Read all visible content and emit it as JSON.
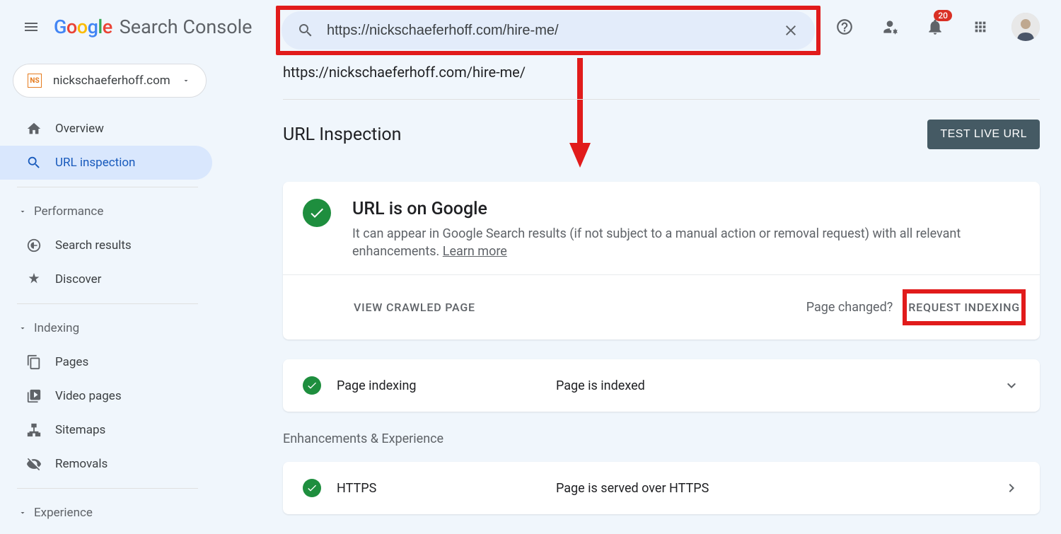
{
  "header": {
    "product_name": "Search Console",
    "search_value": "https://nickschaeferhoff.com/hire-me/",
    "notification_count": "20"
  },
  "sidebar": {
    "property": "nickschaeferhoff.com",
    "favicon_label": "NS",
    "items": {
      "overview": "Overview",
      "url_inspection": "URL inspection"
    },
    "sections": {
      "performance": {
        "title": "Performance",
        "items": {
          "search_results": "Search results",
          "discover": "Discover"
        }
      },
      "indexing": {
        "title": "Indexing",
        "items": {
          "pages": "Pages",
          "video_pages": "Video pages",
          "sitemaps": "Sitemaps",
          "removals": "Removals"
        }
      },
      "experience": {
        "title": "Experience"
      }
    }
  },
  "main": {
    "inspected_url": "https://nickschaeferhoff.com/hire-me/",
    "page_title": "URL Inspection",
    "test_live_btn": "TEST LIVE URL",
    "status": {
      "title": "URL is on Google",
      "desc": "It can appear in Google Search results (if not subject to a manual action or removal request) with all relevant enhancements. ",
      "learn_more": "Learn more"
    },
    "view_crawled": "VIEW CRAWLED PAGE",
    "page_changed": "Page changed?",
    "request_indexing": "REQUEST INDEXING",
    "rows": {
      "page_indexing": {
        "label": "Page indexing",
        "status": "Page is indexed"
      },
      "https": {
        "label": "HTTPS",
        "status": "Page is served over HTTPS"
      }
    },
    "enhancements_title": "Enhancements & Experience"
  }
}
